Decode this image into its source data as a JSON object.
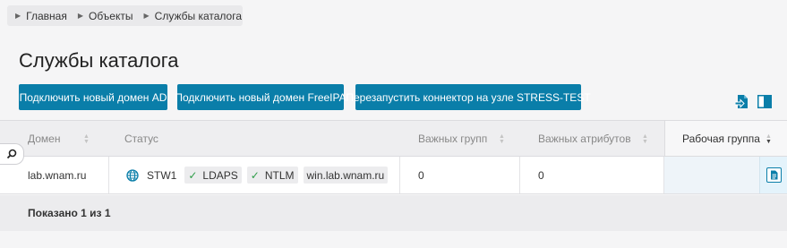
{
  "breadcrumb": [
    {
      "label": "Главная"
    },
    {
      "label": "Объекты"
    },
    {
      "label": "Службы каталога"
    }
  ],
  "page_title": "Службы каталога",
  "actions": {
    "connect_ad": "Подключить новый домен AD",
    "connect_freeipa": "Подключить новый домен FreeIPA",
    "restart_connector": "Перезапустить коннектор на узле STRESS-TEST"
  },
  "toolbar_icons": [
    "export-icon",
    "columns-icon"
  ],
  "table": {
    "headers": {
      "domain": "Домен",
      "status": "Статус",
      "groups": "Важных групп",
      "attributes": "Важных атрибутов",
      "workgroup": "Рабочая группа"
    },
    "rows": [
      {
        "domain": "lab.wnam.ru",
        "status": {
          "server": "STW1",
          "ldaps": "LDAPS",
          "ntlm": "NTLM",
          "host": "win.lab.wnam.ru"
        },
        "groups": "0",
        "attributes": "0",
        "workgroup": ""
      }
    ],
    "footer": "Показано 1 из 1"
  },
  "colors": {
    "accent": "#0a7ea9",
    "check": "#2e9d48"
  }
}
